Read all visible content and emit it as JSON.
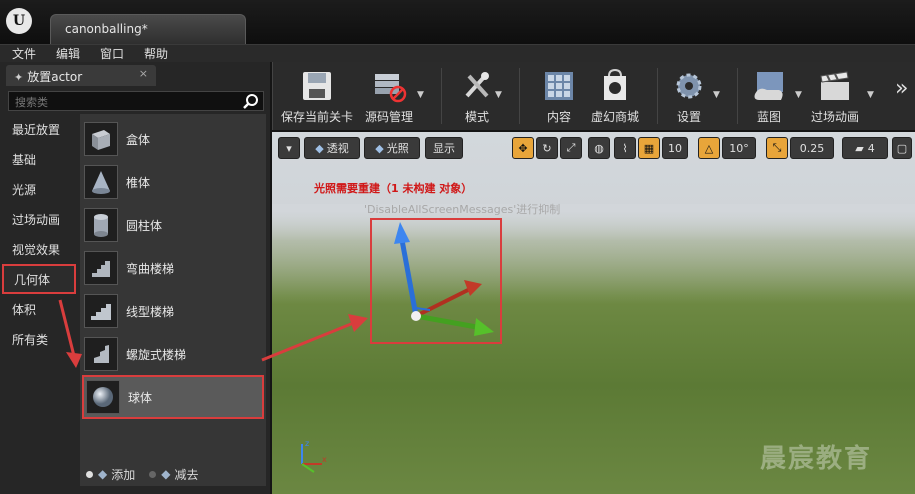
{
  "window": {
    "doc_tab": "canonballing*"
  },
  "menu": [
    "文件",
    "编辑",
    "窗口",
    "帮助"
  ],
  "place_panel": {
    "tab_title": "放置actor",
    "close": "×",
    "search_placeholder": "搜索类",
    "categories": [
      "最近放置",
      "基础",
      "光源",
      "过场动画",
      "视觉效果",
      "几何体",
      "体积",
      "所有类"
    ],
    "items": [
      "盒体",
      "椎体",
      "圆柱体",
      "弯曲楼梯",
      "线型楼梯",
      "螺旋式楼梯",
      "球体"
    ],
    "add_label": "添加",
    "subtract_label": "减去"
  },
  "toolbar": {
    "buttons": [
      "保存当前关卡",
      "源码管理",
      "模式",
      "内容",
      "虚幻商城",
      "设置",
      "蓝图",
      "过场动画"
    ],
    "more": "»"
  },
  "viewport": {
    "perspective": "透视",
    "lit": "光照",
    "show": "显示",
    "grid_snap": "10",
    "rot_snap": "10°",
    "scale_snap": "0.25",
    "cam_speed": "4",
    "warning": "光照需要重建（1 未构建 对象）",
    "suppress_msg": "'DisableAllScreenMessages'进行抑制",
    "watermark": "晨宸教育"
  },
  "colors": {
    "accent": "#e8a53a",
    "highlight": "#d93d3d"
  }
}
